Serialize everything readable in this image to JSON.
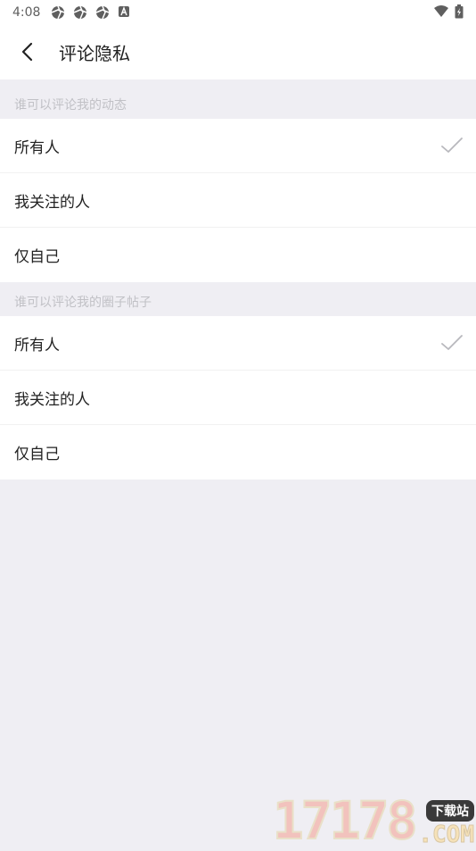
{
  "status_bar": {
    "time": "4:08",
    "notification_icons": [
      "aperture-icon",
      "aperture-icon",
      "aperture-icon",
      "app-a-icon"
    ],
    "right_icons": [
      "wifi-icon",
      "battery-charging-icon"
    ]
  },
  "app_bar": {
    "title": "评论隐私",
    "back_icon": "chevron-left-icon"
  },
  "sections": [
    {
      "header": "谁可以评论我的动态",
      "options": [
        {
          "label": "所有人",
          "selected": true
        },
        {
          "label": "我关注的人",
          "selected": false
        },
        {
          "label": "仅自己",
          "selected": false
        }
      ]
    },
    {
      "header": "谁可以评论我的圈子帖子",
      "options": [
        {
          "label": "所有人",
          "selected": true
        },
        {
          "label": "我关注的人",
          "selected": false
        },
        {
          "label": "仅自己",
          "selected": false
        }
      ]
    }
  ],
  "watermark": {
    "digits": "17178",
    "badge": "下载站",
    "domain": ".COM"
  },
  "colors": {
    "background": "#efeef3",
    "check": "#b8b8bd",
    "header_text": "#c1c1c6",
    "primary_text": "#222222"
  }
}
